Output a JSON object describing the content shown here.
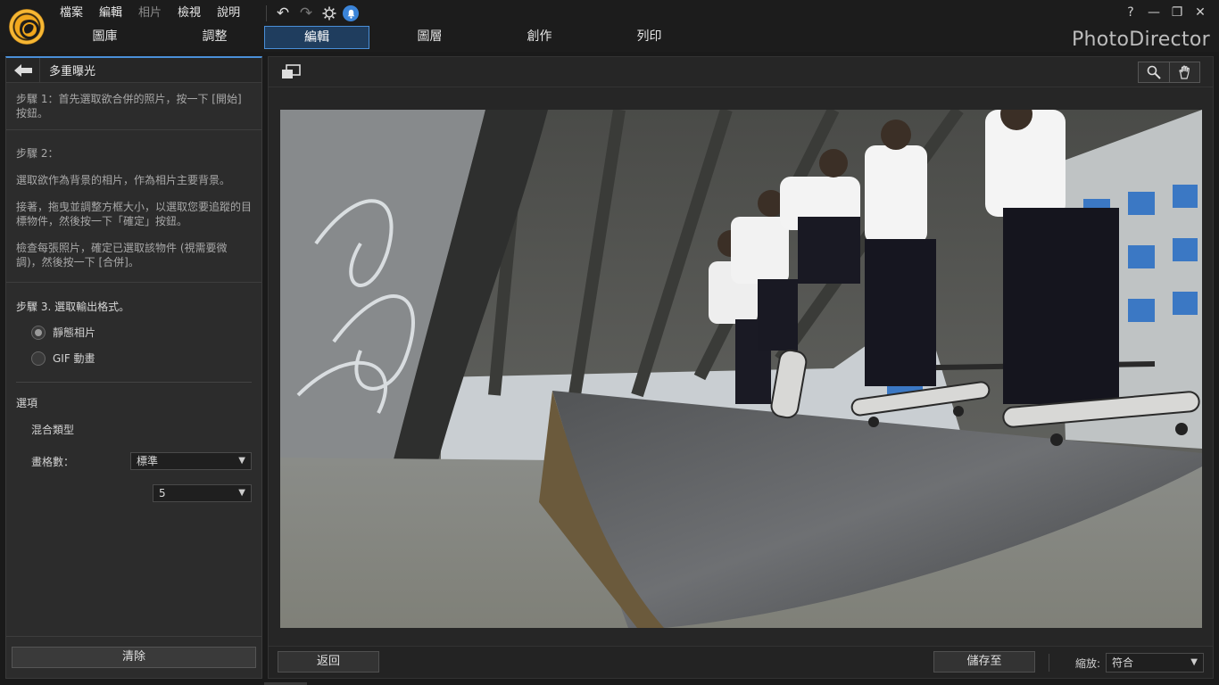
{
  "menu": [
    "檔案",
    "編輯",
    "相片",
    "檢視",
    "說明"
  ],
  "menu_dim_index": 2,
  "window_controls": {
    "help": "?",
    "minimize": "—",
    "restore": "❐",
    "close": "✕"
  },
  "tabs": [
    "圖庫",
    "調整",
    "編輯",
    "圖層",
    "創作",
    "列印"
  ],
  "active_tab": "編輯",
  "brand": "PhotoDirector",
  "left_panel": {
    "title": "多重曝光",
    "step1": "步驟 1：首先選取欲合併的照片，按一下 [開始] 按鈕。",
    "step2_title": "步驟 2：",
    "step2_p1": "選取欲作為背景的相片，作為相片主要背景。",
    "step2_p2": "接著，拖曳並調整方框大小，以選取您要追蹤的目標物件，然後按一下「確定」按鈕。",
    "step2_p3": "檢查每張照片，確定已選取該物件 (視需要微調)，然後按一下 [合併]。",
    "step3_title": "步驟 3. 選取輸出格式。",
    "format_options": [
      {
        "label": "靜態相片",
        "selected": true
      },
      {
        "label": "GIF 動畫",
        "selected": false
      }
    ],
    "options_title": "選項",
    "blend_label": "混合類型",
    "blend_value": "標準",
    "frames_label": "畫格數：",
    "frames_value": "5",
    "clear_button": "清除"
  },
  "bottom_bar": {
    "back_button": "返回",
    "save_button": "儲存至",
    "zoom_label": "縮放:",
    "zoom_value": "符合"
  }
}
